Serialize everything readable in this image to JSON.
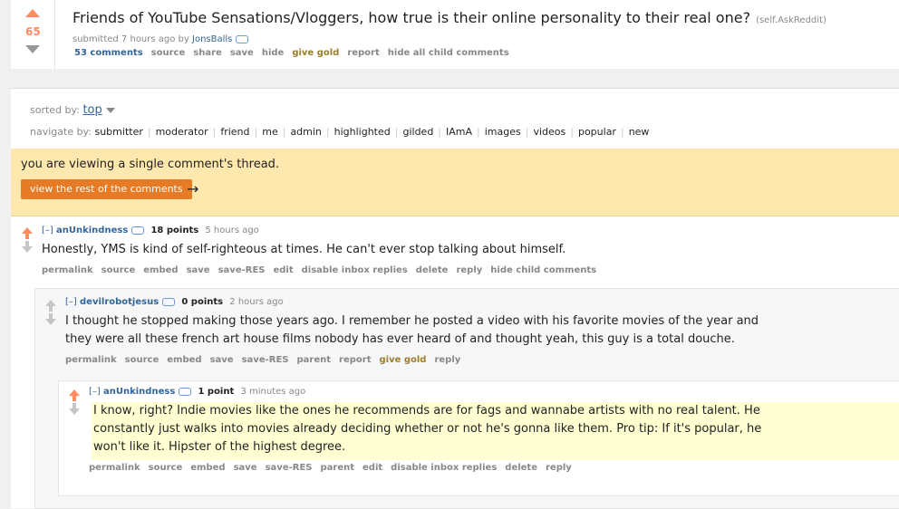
{
  "post": {
    "score": "65",
    "title": "Friends of YouTube Sensations/Vloggers, how true is their online personality to their real one?",
    "domain": "(self.AskReddit)",
    "submitted_prefix": "submitted 7 hours ago by",
    "author": "JonsBalls",
    "buttons": [
      "53 comments",
      "source",
      "share",
      "save",
      "hide",
      "give gold",
      "report",
      "hide all child comments"
    ]
  },
  "sort": {
    "label": "sorted by:",
    "value": "top"
  },
  "navigate": {
    "label": "navigate by:",
    "items": [
      "submitter",
      "moderator",
      "friend",
      "me",
      "admin",
      "highlighted",
      "gilded",
      "IAmA",
      "images",
      "videos",
      "popular",
      "new"
    ]
  },
  "notice": {
    "text": "you are viewing a single comment's thread.",
    "button": "view the rest of the comments",
    "arrow": "→"
  },
  "comments": [
    {
      "expand": "[–]",
      "author": "anUnkindness",
      "points": "18 points",
      "time": "5 hours ago",
      "body": "Honestly, YMS is kind of self-righteous at times. He can't ever stop talking about himself.",
      "buttons": [
        "permalink",
        "source",
        "embed",
        "save",
        "save-RES",
        "edit",
        "disable inbox replies",
        "delete",
        "reply",
        "hide child comments"
      ]
    },
    {
      "expand": "[–]",
      "author": "devilrobotjesus",
      "points": "0 points",
      "time": "2 hours ago",
      "body_lines": [
        "I thought he stopped making those years ago. I remember he posted a video with his favorite movies of the year and",
        "they were all these french art house films nobody has ever heard of and thought yeah, this guy is a total douche."
      ],
      "buttons": [
        "permalink",
        "source",
        "embed",
        "save",
        "save-RES",
        "parent",
        "report",
        "give gold",
        "reply"
      ]
    },
    {
      "expand": "[–]",
      "author": "anUnkindness",
      "points": "1 point",
      "time": "3 minutes ago",
      "body_lines": [
        "I know, right? Indie movies like the ones he recommends are for fags and wannabe artists with no real talent. He",
        "constantly just walks into movies already deciding whether or not he's gonna like them. Pro tip: If it's popular, he",
        "won't like it. Hipster of the highest degree."
      ],
      "buttons": [
        "permalink",
        "source",
        "embed",
        "save",
        "save-RES",
        "parent",
        "edit",
        "disable inbox replies",
        "delete",
        "reply"
      ]
    }
  ],
  "colors": {
    "upvote": "#ff8b60",
    "link": "#336699",
    "notice_bg": "#ffe8ad",
    "button_orange": "#e77a24",
    "highlight": "#ffffd2"
  }
}
